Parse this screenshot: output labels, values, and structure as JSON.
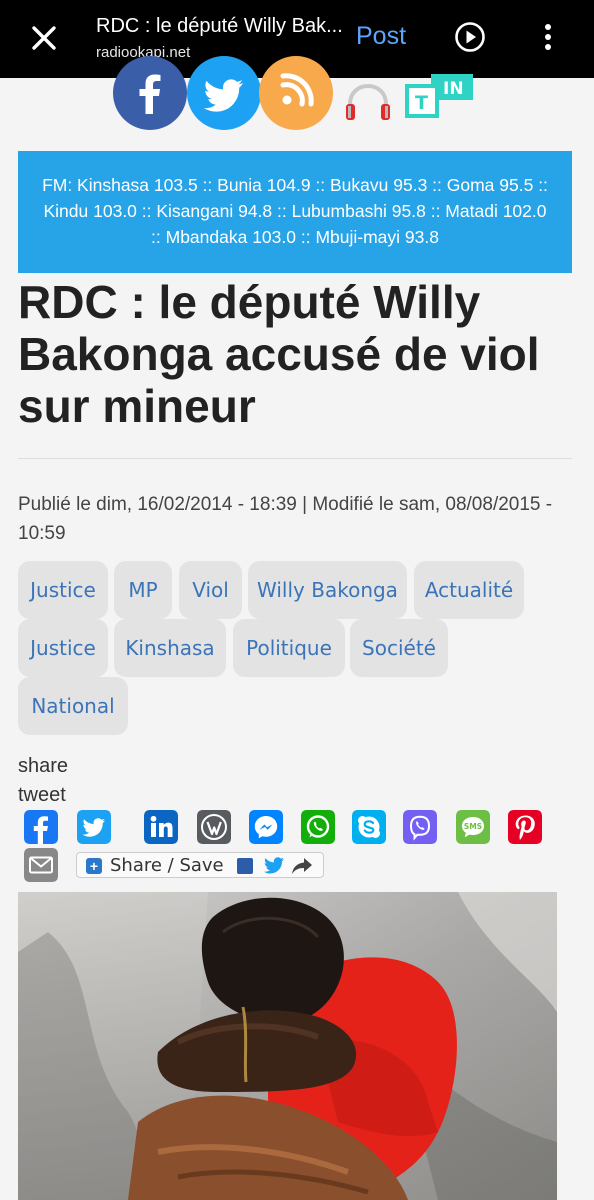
{
  "browser": {
    "page_title": "RDC : le député Willy Bak...",
    "domain": "radiookapi.net",
    "post_label": "Post"
  },
  "social": {
    "tin_label": "IN",
    "tin_letter": "T"
  },
  "fm_banner": "FM: Kinshasa 103.5 :: Bunia 104.9 :: Bukavu 95.3 :: Goma 95.5 :: Kindu 103.0 :: Kisangani 94.8 :: Lubumbashi 95.8 :: Matadi 102.0 :: Mbandaka 103.0 :: Mbuji-mayi 93.8",
  "article": {
    "headline": "RDC : le député Willy Bakonga accusé de viol sur mineur",
    "meta": "Publié le dim, 16/02/2014 - 18:39 | Modifié le sam, 08/08/2015 - 10:59"
  },
  "tags": [
    "Justice",
    "MP",
    "Viol",
    "Willy Bakonga",
    "Actualité",
    "Justice",
    "Kinshasa",
    "Politique",
    "Société",
    "National"
  ],
  "share": {
    "share_label": "share",
    "tweet_label": "tweet",
    "share_save_label": "Share / Save",
    "icons": [
      "facebook-icon",
      "twitter-icon",
      "linkedin-icon",
      "wordpress-icon",
      "messenger-icon",
      "whatsapp-icon",
      "skype-icon",
      "viber-icon",
      "sms-icon",
      "pinterest-icon",
      "email-icon"
    ],
    "sms_text": "SMS"
  },
  "colors": {
    "banner": "#27a3e8",
    "link": "#3b74b8",
    "accent_post": "#5aa6ff"
  }
}
